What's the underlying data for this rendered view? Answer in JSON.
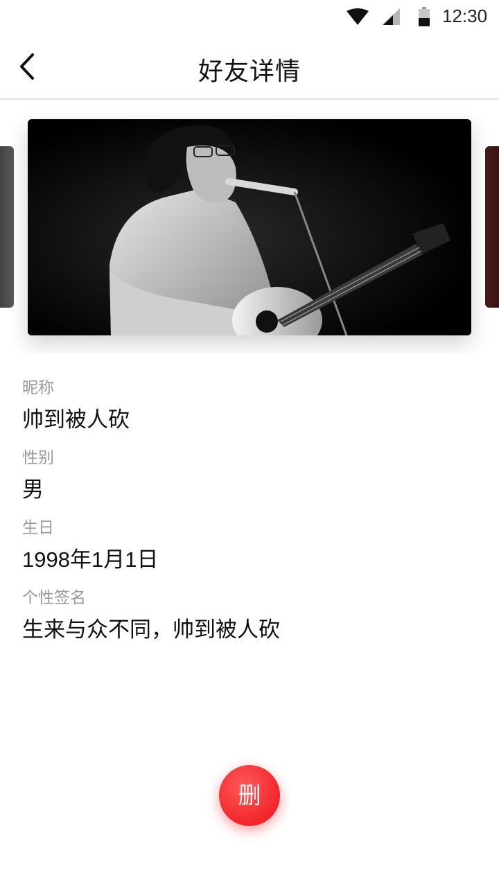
{
  "status_bar": {
    "time": "12:30",
    "icons": [
      "wifi-icon",
      "signal-icon",
      "battery-icon"
    ]
  },
  "nav": {
    "title": "好友详情",
    "back_icon": "chevron-left-icon"
  },
  "profile_photo": {
    "description_icon": "photo"
  },
  "fields": {
    "nickname_label": "昵称",
    "nickname_value": "帅到被人砍",
    "gender_label": "性别",
    "gender_value": "男",
    "birthday_label": "生日",
    "birthday_value": "1998年1月1日",
    "signature_label": "个性签名",
    "signature_value": "生来与众不同，帅到被人砍"
  },
  "delete_button": {
    "label": "删",
    "color": "#f2252a"
  }
}
